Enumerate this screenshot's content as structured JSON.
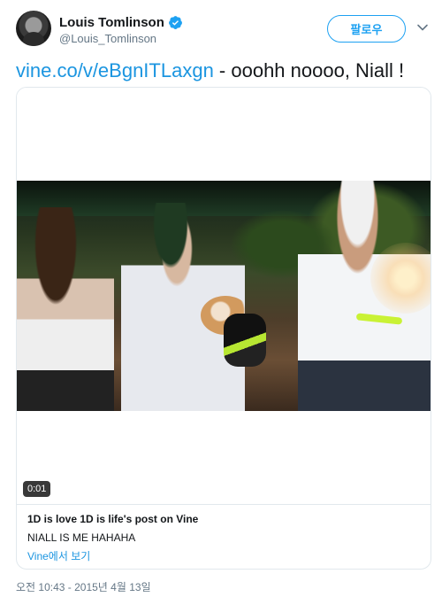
{
  "user": {
    "display_name": "Louis Tomlinson",
    "handle": "@Louis_Tomlinson",
    "verified": true,
    "avatar_icon": "avatar-photo",
    "verified_icon": "verified-badge-icon"
  },
  "actions": {
    "follow_label": "팔로우",
    "menu_icon": "chevron-down-icon"
  },
  "tweet": {
    "link_text": "vine.co/v/eBgnITLaxgn",
    "body_text": " - ooohh noooo, Niall !",
    "timestamp": "오전 10:43 - 2015년 4월 13일"
  },
  "card": {
    "video_duration": "0:01",
    "title": "1D is love 1D is life's post on Vine",
    "description": "NIALL IS ME HAHAHA",
    "domain_link": "Vine에서 보기"
  },
  "colors": {
    "accent": "#1da1f2",
    "link": "#1b95e0",
    "secondary_text": "#657786",
    "border": "#e1e8ed"
  }
}
